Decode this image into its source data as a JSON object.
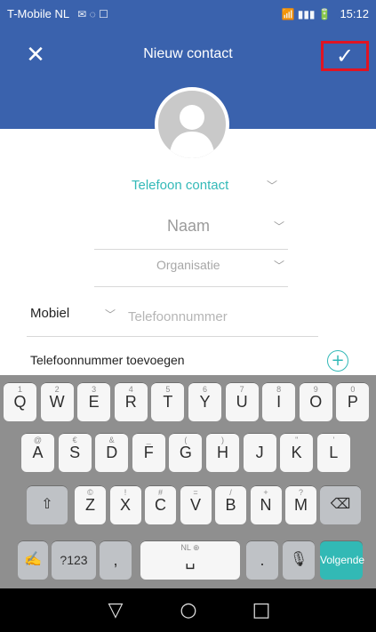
{
  "status_bar": {
    "carrier": "T-Mobile NL",
    "left_icons": "✉ ◌ ☐",
    "time": "15:12",
    "right_icons": "📶 ▮▮▮ 🔋"
  },
  "app_bar": {
    "title": "Nieuw contact",
    "close_icon": "✕",
    "save_icon": "✓"
  },
  "form": {
    "contact_type": "Telefoon contact",
    "name_label": "Naam",
    "organisation_label": "Organisatie",
    "phone_label": "Mobiel",
    "phone_placeholder": "Telefoonnummer",
    "add_phone": "Telefoonnummer toevoegen"
  },
  "keyboard": {
    "row1": [
      {
        "main": "Q",
        "sub": "1"
      },
      {
        "main": "W",
        "sub": "2"
      },
      {
        "main": "E",
        "sub": "3"
      },
      {
        "main": "R",
        "sub": "4"
      },
      {
        "main": "T",
        "sub": "5"
      },
      {
        "main": "Y",
        "sub": "6"
      },
      {
        "main": "U",
        "sub": "7"
      },
      {
        "main": "I",
        "sub": "8"
      },
      {
        "main": "O",
        "sub": "9"
      },
      {
        "main": "P",
        "sub": "0"
      }
    ],
    "row2": [
      {
        "main": "A",
        "sub": "@"
      },
      {
        "main": "S",
        "sub": "€"
      },
      {
        "main": "D",
        "sub": "&"
      },
      {
        "main": "F",
        "sub": "_"
      },
      {
        "main": "G",
        "sub": "("
      },
      {
        "main": "H",
        "sub": ")"
      },
      {
        "main": "J",
        "sub": ""
      },
      {
        "main": "K",
        "sub": "\""
      },
      {
        "main": "L",
        "sub": "'"
      }
    ],
    "row3": [
      {
        "main": "Z",
        "sub": "©"
      },
      {
        "main": "X",
        "sub": "!"
      },
      {
        "main": "C",
        "sub": "#"
      },
      {
        "main": "V",
        "sub": "="
      },
      {
        "main": "B",
        "sub": "/"
      },
      {
        "main": "N",
        "sub": "+"
      },
      {
        "main": "M",
        "sub": "?"
      }
    ],
    "bottom": {
      "hw_label": "✍",
      "symbols_label": "?123",
      "comma": ",",
      "space_sub": "NL ⊕",
      "space_label": "␣",
      "period": ".",
      "mic_label": "🎙",
      "action_label": "Volgende",
      "shift_label": "⇧",
      "backspace_label": "⌫"
    }
  },
  "nav": {
    "back": "▽",
    "home": "○",
    "recent": "□"
  },
  "colors": {
    "header": "#3a62ad",
    "accent": "#33b9b8",
    "highlight": "#e01422"
  }
}
